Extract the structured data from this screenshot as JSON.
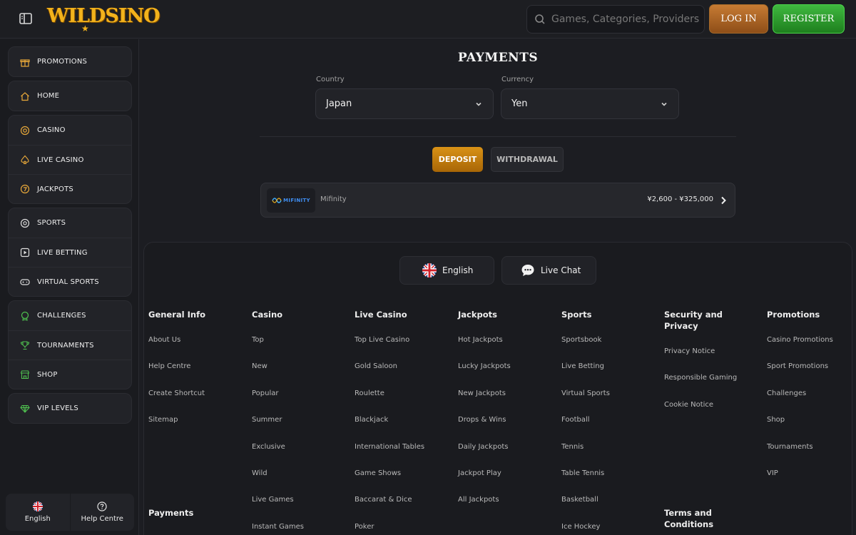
{
  "header": {
    "logo_text": "WILDSINO",
    "search_placeholder": "Games, Categories, Providers",
    "login_label": "LOG IN",
    "register_label": "REGISTER"
  },
  "sidebar": {
    "group1": [
      {
        "label": "PROMOTIONS",
        "icon": "gift-icon"
      }
    ],
    "group2": [
      {
        "label": "HOME",
        "icon": "home-icon"
      }
    ],
    "group3": [
      {
        "label": "CASINO",
        "icon": "casino-chip-icon"
      },
      {
        "label": "LIVE CASINO",
        "icon": "spade-icon"
      },
      {
        "label": "JACKPOTS",
        "icon": "jackpot-icon"
      }
    ],
    "group4": [
      {
        "label": "SPORTS",
        "icon": "soccer-ball-icon"
      },
      {
        "label": "LIVE BETTING",
        "icon": "play-icon"
      },
      {
        "label": "VIRTUAL SPORTS",
        "icon": "gamepad-icon"
      }
    ],
    "group5": [
      {
        "label": "CHALLENGES",
        "icon": "medal-icon"
      },
      {
        "label": "TOURNAMENTS",
        "icon": "trophy-icon"
      },
      {
        "label": "SHOP",
        "icon": "shop-icon"
      }
    ],
    "group6": [
      {
        "label": "VIP LEVELS",
        "icon": "diamond-icon"
      }
    ],
    "bottom": {
      "language": "English",
      "help": "Help Centre"
    }
  },
  "payments": {
    "title": "PAYMENTS",
    "country_label": "Country",
    "country_value": "Japan",
    "currency_label": "Currency",
    "currency_value": "Yen",
    "tab_deposit": "DEPOSIT",
    "tab_withdrawal": "WITHDRAWAL",
    "method": {
      "logo_text": "MIFINITY",
      "name": "Mifinity",
      "range": "¥2,600 - ¥325,000"
    }
  },
  "footer": {
    "language_pill": "English",
    "chat_pill": "Live Chat",
    "columns": [
      {
        "heading": "General Info",
        "links": [
          "About Us",
          "Help Centre",
          "Create Shortcut",
          "Sitemap"
        ]
      },
      {
        "heading": "Casino",
        "links": [
          "Top",
          "New",
          "Popular",
          "Summer",
          "Exclusive",
          "Wild",
          "Live Games",
          "Instant Games"
        ]
      },
      {
        "heading": "Live Casino",
        "links": [
          "Top Live Casino",
          "Gold Saloon",
          "Roulette",
          "Blackjack",
          "International Tables",
          "Game Shows",
          "Baccarat & Dice",
          "Poker"
        ]
      },
      {
        "heading": "Jackpots",
        "links": [
          "Hot Jackpots",
          "Lucky Jackpots",
          "New Jackpots",
          "Drops & Wins",
          "Daily Jackpots",
          "Jackpot Play",
          "All Jackpots"
        ]
      },
      {
        "heading": "Sports",
        "links": [
          "Sportsbook",
          "Live Betting",
          "Virtual Sports",
          "Football",
          "Tennis",
          "Table Tennis",
          "Basketball",
          "Ice Hockey"
        ]
      },
      {
        "heading": "Security and Privacy",
        "links": [
          "Privacy Notice",
          "Responsible Gaming",
          "Cookie Notice"
        ]
      },
      {
        "heading": "Promotions",
        "links": [
          "Casino Promotions",
          "Sport Promotions",
          "Challenges",
          "Shop",
          "Tournaments",
          "VIP"
        ]
      }
    ],
    "payments_heading": "Payments",
    "terms_heading": "Terms and Conditions"
  },
  "colors": {
    "accent_gold": "#f2b21c",
    "deposit": "#d99216",
    "register": "#3fb83f",
    "login": "#c77b33"
  }
}
